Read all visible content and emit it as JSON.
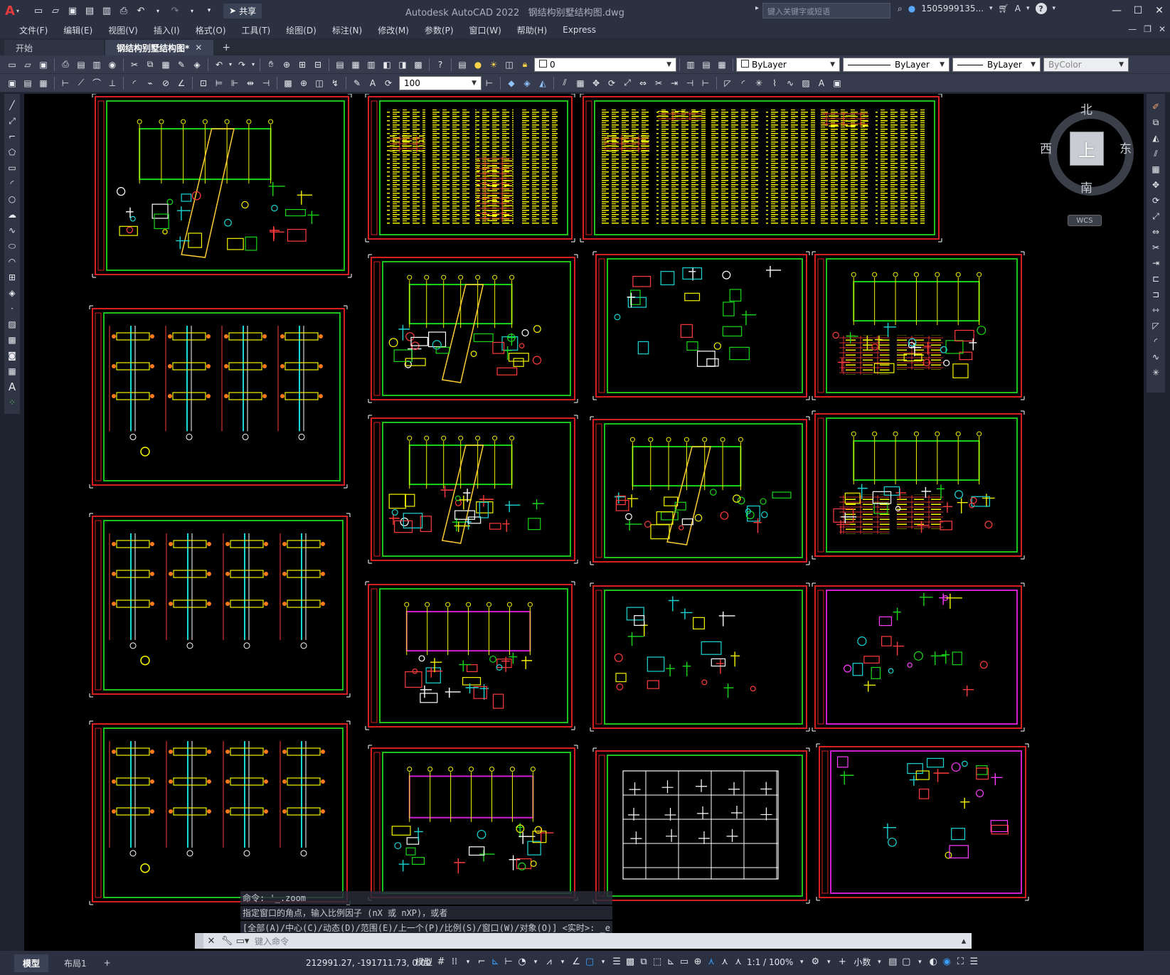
{
  "app": {
    "logo": "A",
    "title": "Autodesk AutoCAD 2022",
    "filename": "钢结构别墅结构图.dwg",
    "share_label": "共享",
    "search_placeholder": "键入关键字或短语",
    "user": "1505999135...",
    "help": "?"
  },
  "menu": {
    "items": [
      "文件(F)",
      "编辑(E)",
      "视图(V)",
      "插入(I)",
      "格式(O)",
      "工具(T)",
      "绘图(D)",
      "标注(N)",
      "修改(M)",
      "参数(P)",
      "窗口(W)",
      "帮助(H)",
      "Express"
    ]
  },
  "tabs": {
    "start": "开始",
    "active": "钢结构别墅结构图*",
    "add": "+"
  },
  "properties": {
    "layer": "0",
    "color": "ByLayer",
    "linetype": "ByLayer",
    "lineweight": "ByLayer",
    "plotstyle": "ByColor",
    "scale": "100"
  },
  "viewcube": {
    "top": "上",
    "north": "北",
    "south": "南",
    "east": "东",
    "west": "西",
    "wcs": "WCS"
  },
  "command": {
    "history": [
      "命令: '_.zoom",
      "指定窗口的角点，输入比例因子 (nX 或 nXP)，或者",
      "[全部(A)/中心(C)/动态(D)/范围(E)/上一个(P)/比例(S)/窗口(W)/对象(O)] <实时>: _e"
    ],
    "placeholder": "键入命令"
  },
  "status": {
    "model_tab": "模型",
    "layout_tab": "布局1",
    "add": "+",
    "coords": "212991.27, -191711.73, 0.00",
    "mode": "模型",
    "annoscale": "1:1 / 100%",
    "units": "小数"
  },
  "colors": {
    "sheet_border": "#d71f1f",
    "inner_border": "#1ec01e",
    "drawing_bg": "#000000",
    "accent": "#3aa0ff"
  }
}
